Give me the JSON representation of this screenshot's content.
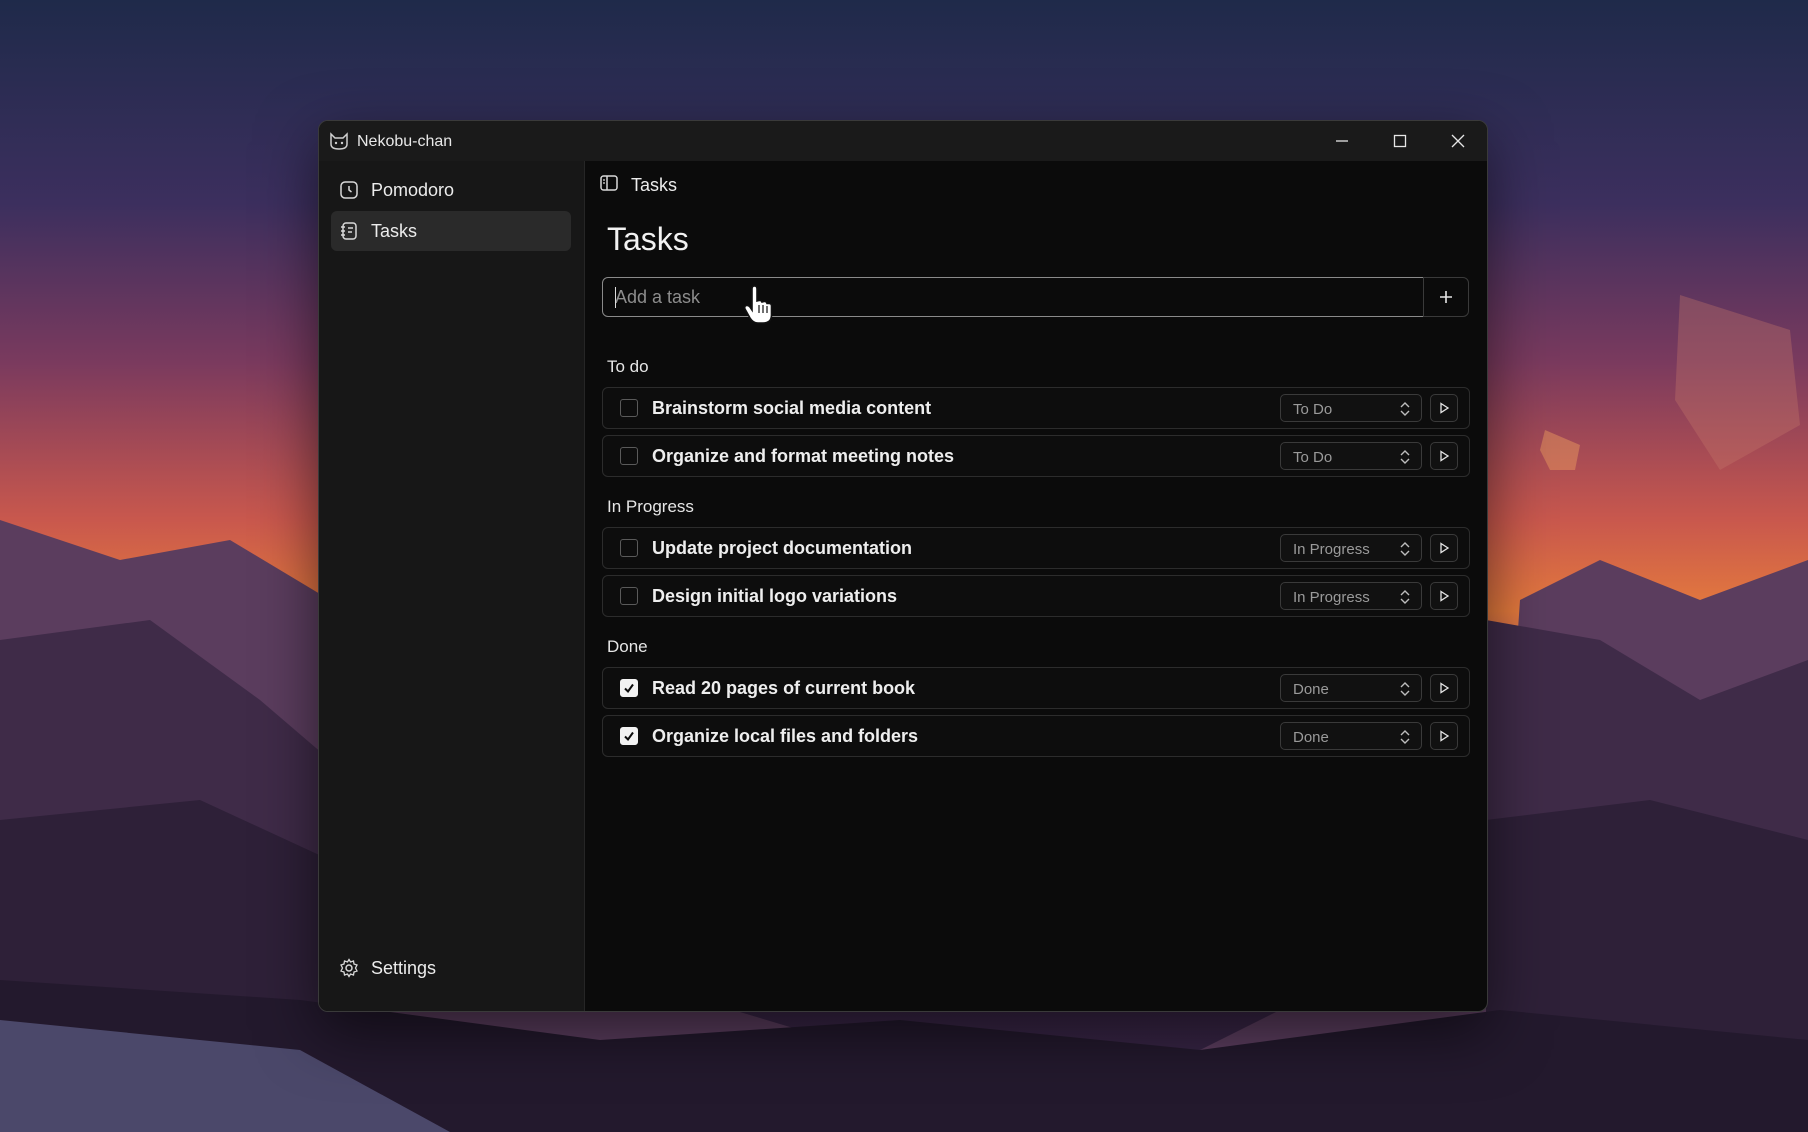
{
  "window": {
    "title": "Nekobu-chan"
  },
  "sidebar": {
    "items": [
      {
        "label": "Pomodoro",
        "icon": "clock-icon",
        "active": false
      },
      {
        "label": "Tasks",
        "icon": "list-icon",
        "active": true
      }
    ],
    "settings_label": "Settings"
  },
  "header": {
    "breadcrumb": "Tasks"
  },
  "main": {
    "title": "Tasks",
    "add_task": {
      "placeholder": "Add a task",
      "value": "",
      "button_icon": "plus-icon"
    },
    "sections": [
      {
        "label": "To do",
        "tasks": [
          {
            "title": "Brainstorm social media content",
            "status": "To Do",
            "done": false
          },
          {
            "title": "Organize and format meeting notes",
            "status": "To Do",
            "done": false
          }
        ]
      },
      {
        "label": "In Progress",
        "tasks": [
          {
            "title": "Update project documentation",
            "status": "In Progress",
            "done": false
          },
          {
            "title": "Design initial logo variations",
            "status": "In Progress",
            "done": false
          }
        ]
      },
      {
        "label": "Done",
        "tasks": [
          {
            "title": "Read 20 pages of current book",
            "status": "Done",
            "done": true
          },
          {
            "title": "Organize local files and folders",
            "status": "Done",
            "done": true
          }
        ]
      }
    ]
  },
  "colors": {
    "window_bg": "#0b0b0b",
    "sidebar_bg": "#171717",
    "active_item_bg": "#2a2a2a",
    "text": "#ececec",
    "muted": "#9a9a9a"
  }
}
